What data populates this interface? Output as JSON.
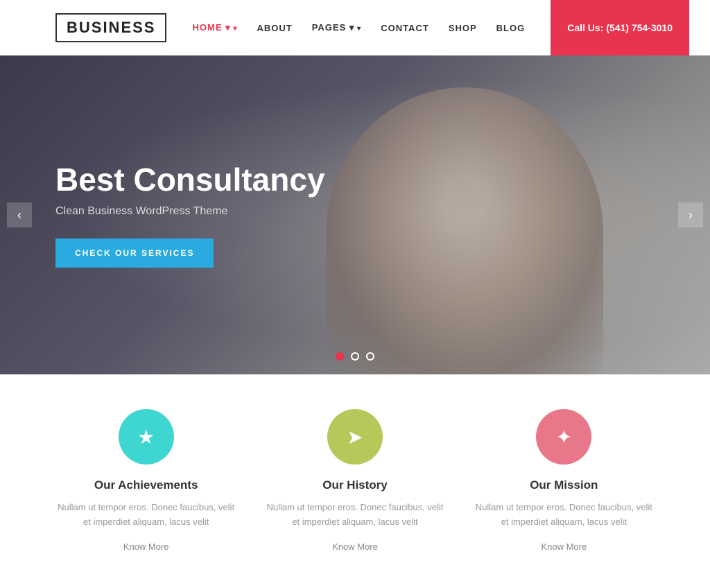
{
  "header": {
    "logo": "BUSINESS",
    "nav": [
      {
        "label": "HOME",
        "active": true,
        "has_dropdown": true
      },
      {
        "label": "ABOUT",
        "active": false,
        "has_dropdown": false
      },
      {
        "label": "PAGES",
        "active": false,
        "has_dropdown": true
      },
      {
        "label": "CONTACT",
        "active": false,
        "has_dropdown": false
      },
      {
        "label": "SHOP",
        "active": false,
        "has_dropdown": false
      },
      {
        "label": "BLOG",
        "active": false,
        "has_dropdown": false
      }
    ],
    "cta_label": "Call Us: (541) 754-3010"
  },
  "hero": {
    "title": "Best Consultancy",
    "subtitle": "Clean Business WordPress Theme",
    "button_label": "CHECK OUR SERVICES",
    "prev_icon": "‹",
    "next_icon": "›",
    "dots": [
      {
        "active": true
      },
      {
        "active": false
      },
      {
        "active": false
      }
    ]
  },
  "features": [
    {
      "icon": "★",
      "icon_color": "cyan",
      "title": "Our Achievements",
      "desc": "Nullam ut tempor eros. Donec faucibus, velit et imperdiet aliquam, lacus velit",
      "link": "Know More"
    },
    {
      "icon": "➤",
      "icon_color": "green",
      "title": "Our History",
      "desc": "Nullam ut tempor eros. Donec faucibus, velit et imperdiet aliquam, lacus velit",
      "link": "Know More"
    },
    {
      "icon": "✦",
      "icon_color": "pink",
      "title": "Our Mission",
      "desc": "Nullam ut tempor eros. Donec faucibus, velit et imperdiet aliquam, lacus velit",
      "link": "Know More"
    }
  ],
  "colors": {
    "accent_red": "#e8344e",
    "accent_blue": "#29abe2",
    "cyan": "#3dd6d0",
    "green": "#b5c95a",
    "pink": "#e8778a"
  }
}
